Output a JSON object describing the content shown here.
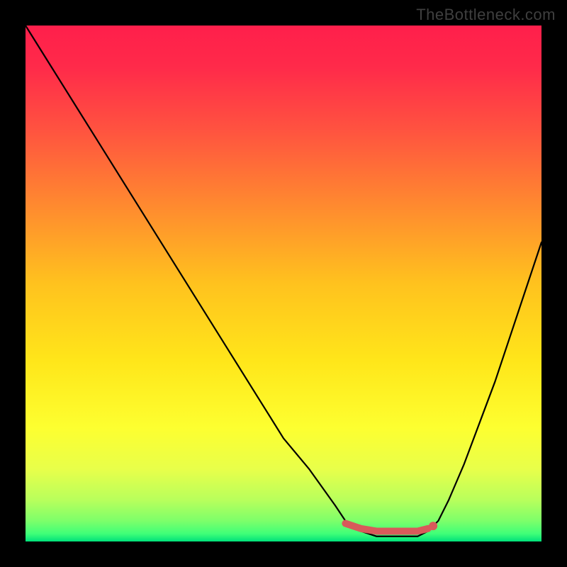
{
  "watermark": "TheBottleneck.com",
  "chart_data": {
    "type": "line",
    "title": "",
    "xlabel": "",
    "ylabel": "",
    "xlim": [
      0,
      100
    ],
    "ylim": [
      0,
      100
    ],
    "grid": false,
    "series": [
      {
        "name": "bottleneck-curve",
        "x": [
          0,
          5,
          10,
          15,
          20,
          25,
          30,
          35,
          40,
          45,
          50,
          55,
          60,
          62,
          65,
          68,
          70,
          72,
          74,
          76,
          78,
          80,
          82,
          85,
          88,
          91,
          94,
          97,
          100
        ],
        "y": [
          100,
          92,
          84,
          76,
          68,
          60,
          52,
          44,
          36,
          28,
          20,
          14,
          7,
          4,
          2,
          1,
          1,
          1,
          1,
          1,
          2,
          4,
          8,
          15,
          23,
          31,
          40,
          49,
          58
        ]
      },
      {
        "name": "highlight-segment",
        "x": [
          62,
          65,
          68,
          70,
          72,
          74,
          76,
          78
        ],
        "y": [
          3.5,
          2.5,
          2.0,
          2.0,
          2.0,
          2.0,
          2.0,
          2.5
        ]
      }
    ],
    "highlight_dot": {
      "x": 79,
      "y": 3.0
    },
    "gradient_stops": [
      {
        "offset": 0.0,
        "color": "#ff1f4b"
      },
      {
        "offset": 0.08,
        "color": "#ff2a4a"
      },
      {
        "offset": 0.2,
        "color": "#ff5240"
      },
      {
        "offset": 0.35,
        "color": "#ff8a2f"
      },
      {
        "offset": 0.5,
        "color": "#ffc21e"
      },
      {
        "offset": 0.65,
        "color": "#ffe61a"
      },
      {
        "offset": 0.78,
        "color": "#fdff30"
      },
      {
        "offset": 0.86,
        "color": "#e8ff4a"
      },
      {
        "offset": 0.92,
        "color": "#b8ff5c"
      },
      {
        "offset": 0.96,
        "color": "#7dff6a"
      },
      {
        "offset": 0.985,
        "color": "#3fff78"
      },
      {
        "offset": 1.0,
        "color": "#00e07a"
      }
    ]
  }
}
